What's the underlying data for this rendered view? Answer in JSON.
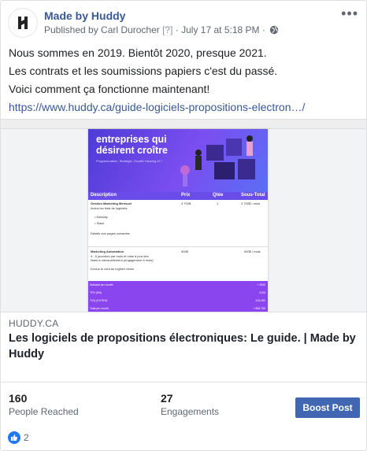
{
  "header": {
    "page_name": "Made by Huddy",
    "published_by": "Published by Carl Durocher",
    "help_marker": "[?]",
    "separator": "·",
    "timestamp": "July 17 at 5:18 PM",
    "more_label": "•••"
  },
  "post": {
    "lines": [
      "Nous sommes en 2019. Bientôt 2020, presque 2021.",
      "Les contrats et les soumissions papiers c'est du passé.",
      "Voici comment ça fonctionne maintenant!"
    ],
    "link_text": "https://www.huddy.ca/guide-logiciels-propositions-electron…/"
  },
  "preview": {
    "hero_title": "entreprises qui désirent croître",
    "hero_subtitle": "Programmation, Stratégie, Growth Hacking et +",
    "table_headers": [
      "Description",
      "Prix",
      "Qtée",
      "Sous-Total"
    ],
    "rows": [
      {
        "title": "Gestion Marketing Mensuel",
        "details": [
          "Inclus les frais de logiciels:",
          "• Monday",
          "• Slack",
          "Détails aux pages suivantes"
        ],
        "price": "3 700$",
        "qty": "1",
        "subtotal": "3 700$ / mois"
      },
      {
        "title": "Marketing Automation",
        "details": [
          "4 - 6 journées par mois et mise à jour des",
          "listes à mensuellement (engagement 6 mois)",
          "Exclus le coût du logiciel choisi"
        ],
        "price": "500$",
        "qty": "",
        "subtotal": "500$ / mois"
      }
    ],
    "totals": [
      {
        "label": "Subtotal per month",
        "value": "+ 2500"
      },
      {
        "label": "TPS (5%)",
        "value": "2103"
      },
      {
        "label": "TVQ (9.975%)",
        "value": "416,250"
      },
      {
        "label": "Total per month",
        "value": "+ 808,750"
      }
    ],
    "domain": "HUDDY.CA",
    "headline": "Les logiciels de propositions électroniques: Le guide. | Made by Huddy"
  },
  "stats": {
    "reached_value": "160",
    "reached_label": "People Reached",
    "engagements_value": "27",
    "engagements_label": "Engagements",
    "boost_label": "Boost Post"
  },
  "reactions": {
    "count": "2",
    "icon": "like-icon"
  },
  "colors": {
    "link": "#385898",
    "boost": "#4267b2",
    "like": "#2078f4",
    "hero": "#5a3fe0",
    "totals": "#8b45ee"
  }
}
